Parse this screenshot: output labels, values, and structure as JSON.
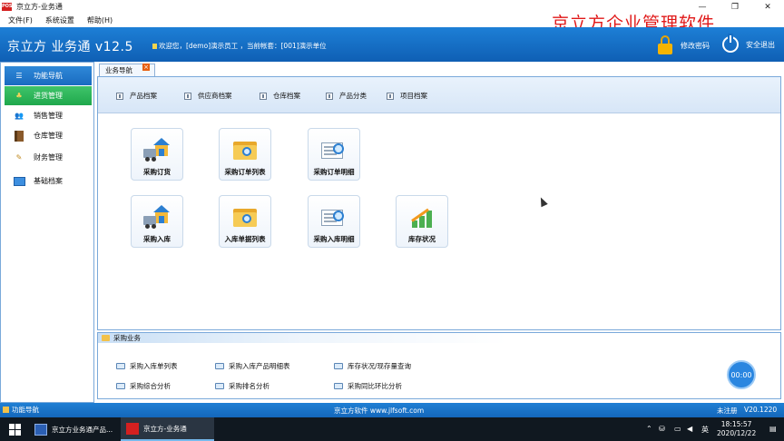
{
  "window": {
    "title": "京立方-业务通",
    "app_icon_text": "POS"
  },
  "menu": [
    "文件(F)",
    "系统设置",
    "帮助(H)"
  ],
  "brand_banner": "京立方企业管理软件",
  "header": {
    "app_title": "京立方  业务通  v12.5",
    "welcome": "欢迎您，[demo]演示员工 ，当前帐套：[001]演示单位",
    "change_password": "修改密码",
    "logout": "安全退出"
  },
  "sidebar": {
    "items": [
      {
        "label": "功能导航",
        "icon": "list-icon"
      },
      {
        "label": "进货管理",
        "icon": "tree-icon"
      },
      {
        "label": "销售管理",
        "icon": "users-icon"
      },
      {
        "label": "仓库管理",
        "icon": "book-icon"
      },
      {
        "label": "财务管理",
        "icon": "note-icon"
      },
      {
        "label": "基础档案",
        "icon": "monitor-icon"
      }
    ]
  },
  "tab": {
    "label": "业务导航",
    "close": "×"
  },
  "quickbar": [
    "产品档案",
    "供应商档案",
    "仓库档案",
    "产品分类",
    "项目档案"
  ],
  "tiles": [
    {
      "label": "采购订货",
      "icon": "truck-warehouse-icon"
    },
    {
      "label": "采购订单列表",
      "icon": "folder-search-icon"
    },
    {
      "label": "采购订单明细",
      "icon": "document-search-icon"
    },
    {
      "label": "采购入库",
      "icon": "truck-warehouse-icon"
    },
    {
      "label": "入库单据列表",
      "icon": "folder-search-icon"
    },
    {
      "label": "采购入库明细",
      "icon": "document-search-icon"
    },
    {
      "label": "库存状况",
      "icon": "growth-chart-icon"
    }
  ],
  "business": {
    "title": "采购业务",
    "links": [
      "采购入库单列表",
      "采购入库产品明细表",
      "库存状况/现存量查询",
      "采购综合分析",
      "采购排名分析",
      "采购同比环比分析"
    ]
  },
  "timer": "00:00",
  "status": {
    "left": "功能导航",
    "center": "京立方软件 www.jlfsoft.com",
    "registration": "未注册",
    "version": "V20.1220"
  },
  "taskbar": {
    "apps": [
      "京立方业务通产品...",
      "京立方-业务通"
    ],
    "ime": "英",
    "time": "18:15:57",
    "date": "2020/12/22"
  },
  "colors": {
    "header": "#1670c8",
    "brand_red": "#e01818",
    "active_green": "#1fa84c"
  }
}
